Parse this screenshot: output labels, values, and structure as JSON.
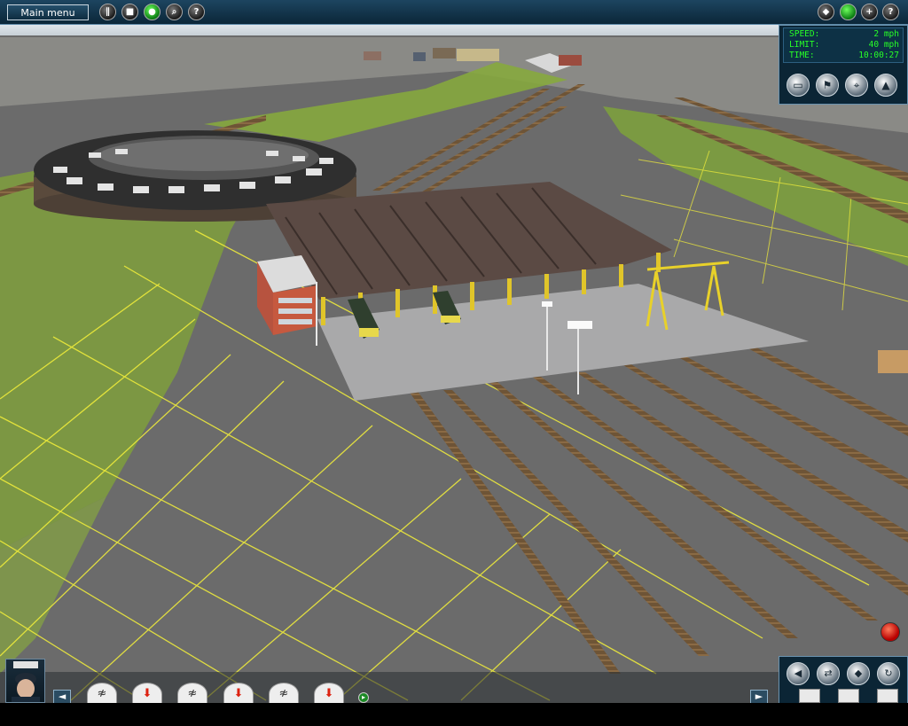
{
  "topbar": {
    "main_menu_label": "Main menu",
    "left_icons": [
      "pause-icon",
      "stop-icon",
      "record-icon",
      "zoom-icon",
      "help-icon"
    ],
    "help_glyph": "?",
    "right_icons": [
      "layers-icon",
      "status-light-icon",
      "add-icon",
      "help-icon"
    ]
  },
  "hud": {
    "speed_label": "SPEED:",
    "speed_value": "2 mph",
    "limit_label": "LIMIT:",
    "limit_value": "40 mph",
    "time_label": "TIME:",
    "time_value": "10:00:27",
    "buttons": [
      "train-view-icon",
      "flag-icon",
      "camera-icon",
      "compass-icon"
    ]
  },
  "bottombar": {
    "commands": [
      "navigate-icon",
      "drop-cargo-icon",
      "navigate-icon",
      "drop-cargo-icon",
      "navigate-icon",
      "drop-cargo-icon"
    ],
    "left_arrow": "◄",
    "right_arrow": "►"
  },
  "bottom_right_panel": {
    "buttons": [
      "sound-icon",
      "switch-icon",
      "direction-icon",
      "refresh-icon"
    ]
  },
  "colors": {
    "hud_text": "#27ff27",
    "panel_bg": "#0b2535",
    "grid_line": "#f4f03a",
    "grass": "#7fa33a",
    "ground": "#6a6a6a"
  }
}
